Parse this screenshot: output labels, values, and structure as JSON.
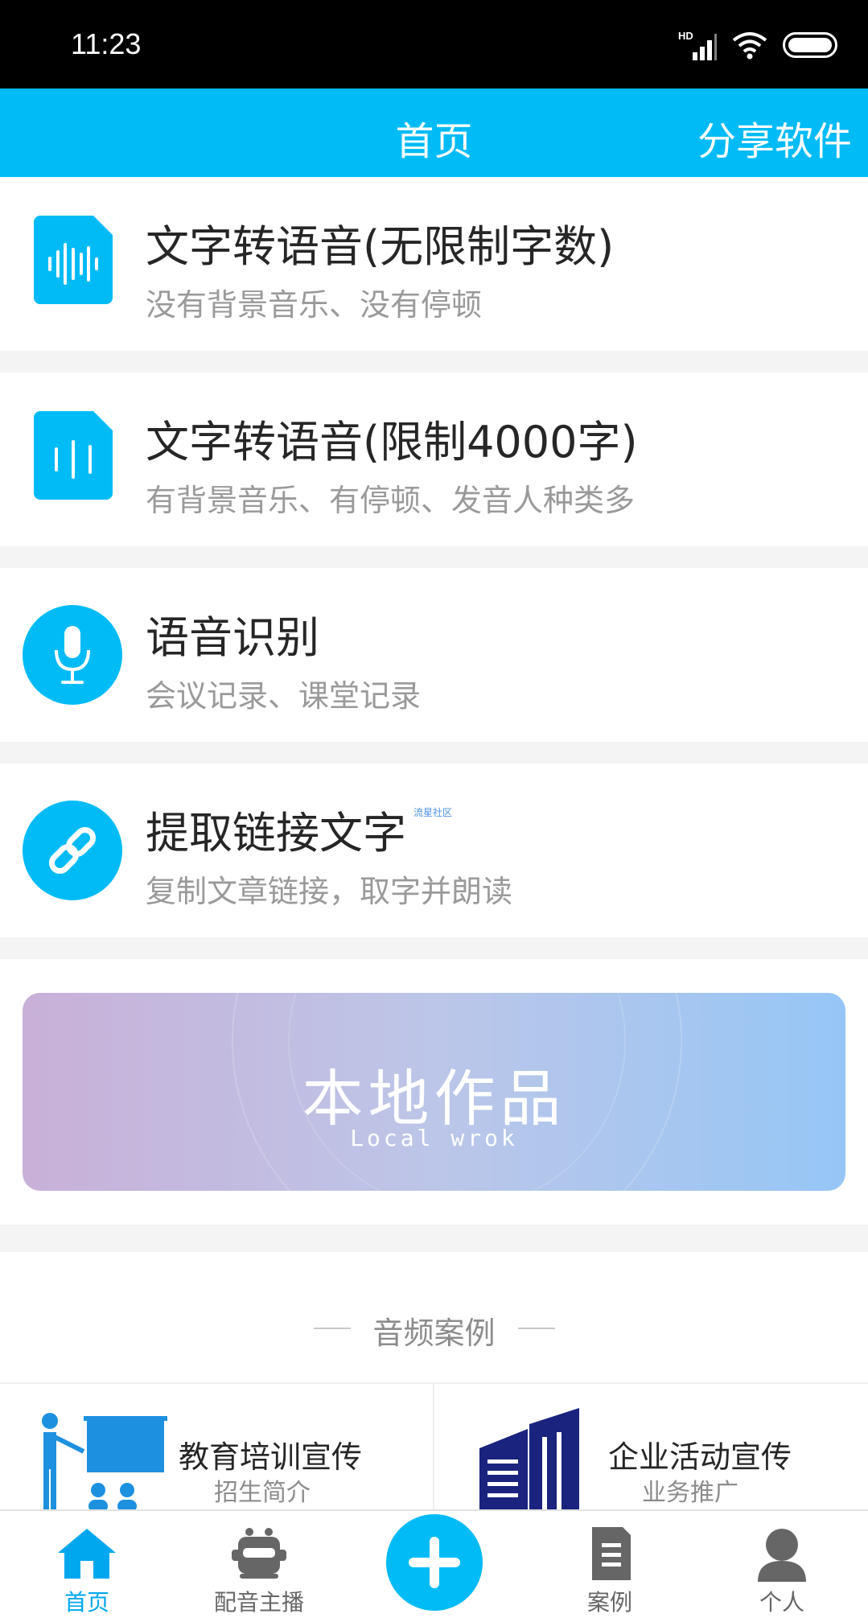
{
  "status_bar": {
    "time": "11:23",
    "network_label": "HD"
  },
  "header": {
    "title": "首页",
    "share_label": "分享软件"
  },
  "features": [
    {
      "title": "文字转语音(无限制字数)",
      "subtitle": "没有背景音乐、没有停顿",
      "icon": "audio-file-icon"
    },
    {
      "title": "文字转语音(限制4000字)",
      "subtitle": "有背景音乐、有停顿、发音人种类多",
      "icon": "audio-file-icon"
    },
    {
      "title": "语音识别",
      "subtitle": "会议记录、课堂记录",
      "icon": "microphone-icon"
    },
    {
      "title": "提取链接文字",
      "subtitle": "复制文章链接，取字并朗读",
      "icon": "link-icon",
      "tag": "流星社区"
    }
  ],
  "banner": {
    "title": "本地作品",
    "subtitle": "Local wrok"
  },
  "cases": {
    "section_title": "音频案例",
    "items": [
      {
        "title": "教育培训宣传",
        "subtitle": "招生简介",
        "icon": "teacher-icon"
      },
      {
        "title": "企业活动宣传",
        "subtitle": "业务推广",
        "icon": "building-icon"
      }
    ]
  },
  "tabs": [
    {
      "label": "首页",
      "icon": "home-icon",
      "active": true
    },
    {
      "label": "配音主播",
      "icon": "robot-icon",
      "active": false
    },
    {
      "label": "",
      "icon": "plus-icon",
      "active": false
    },
    {
      "label": "案例",
      "icon": "document-icon",
      "active": false
    },
    {
      "label": "个人",
      "icon": "person-icon",
      "active": false
    }
  ],
  "colors": {
    "accent": "#00bbf5",
    "background": "#f4f4f4",
    "tab_active": "#00a7ee",
    "banner_left": "#c9b0d8",
    "banner_right": "#96c6f6"
  }
}
